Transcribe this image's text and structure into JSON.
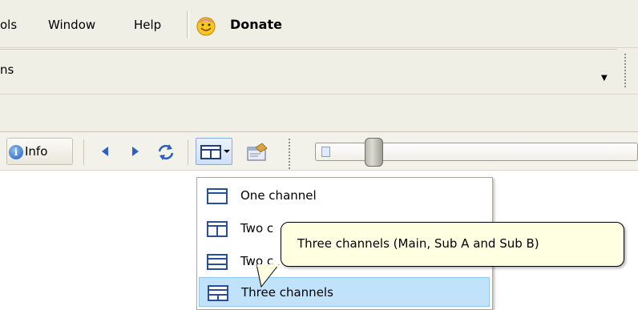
{
  "menubar": {
    "items": [
      "ols",
      "Window",
      "Help"
    ],
    "donate_label": "Donate"
  },
  "address": {
    "value": "ns"
  },
  "toolbar": {
    "info_label": "Info"
  },
  "slider": {
    "position": 0.16
  },
  "view_menu": {
    "items": [
      {
        "label": "One channel",
        "icon": "one-channel-icon"
      },
      {
        "label": "Two c",
        "icon": "two-channels-vertical-icon"
      },
      {
        "label": "Two c",
        "icon": "two-channels-horizontal-icon"
      },
      {
        "label": "Three channels",
        "icon": "three-channels-icon"
      }
    ],
    "highlighted_index": 3
  },
  "tooltip": {
    "text": "Three channels (Main, Sub A and Sub B)"
  },
  "colors": {
    "chrome": "#f0efe6",
    "highlight": "#c1e2fb",
    "tooltip_bg": "#ffffe1",
    "accent_blue": "#2a5fc7"
  }
}
